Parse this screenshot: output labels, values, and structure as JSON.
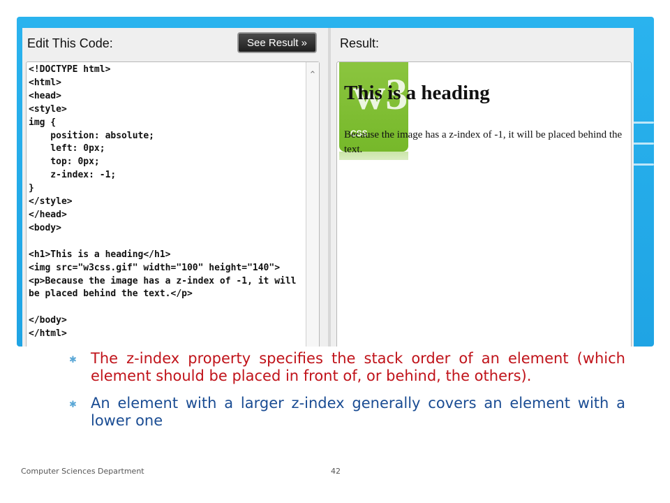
{
  "editor": {
    "edit_title": "Edit This Code:",
    "see_result_label": "See Result »",
    "code": "<!DOCTYPE html>\n<html>\n<head>\n<style>\nimg {\n    position: absolute;\n    left: 0px;\n    top: 0px;\n    z-index: -1;\n}\n</style>\n</head>\n<body>\n\n<h1>This is a heading</h1>\n<img src=\"w3css.gif\" width=\"100\" height=\"140\">\n<p>Because the image has a z-index of -1, it will\nbe placed behind the text.</p>\n\n</body>\n</html>"
  },
  "result": {
    "title": "Result:",
    "heading": "This is a heading",
    "paragraph": "Because the image has a z-index of -1, it will be placed behind the text.",
    "logo_text": "w3",
    "logo_sub": "CSS"
  },
  "bullets": [
    "The z-index property specifies the stack order of an element (which element should be placed in front of, or behind, the others).",
    "An element with a larger z-index generally covers an element with a lower one"
  ],
  "footer": {
    "department": "Computer Sciences Department",
    "page": "42"
  },
  "colors": {
    "band": "#2ab3ee",
    "bullet1": "#c0131a",
    "bullet2": "#1a4c93",
    "logo_green": "#8bc53f"
  }
}
